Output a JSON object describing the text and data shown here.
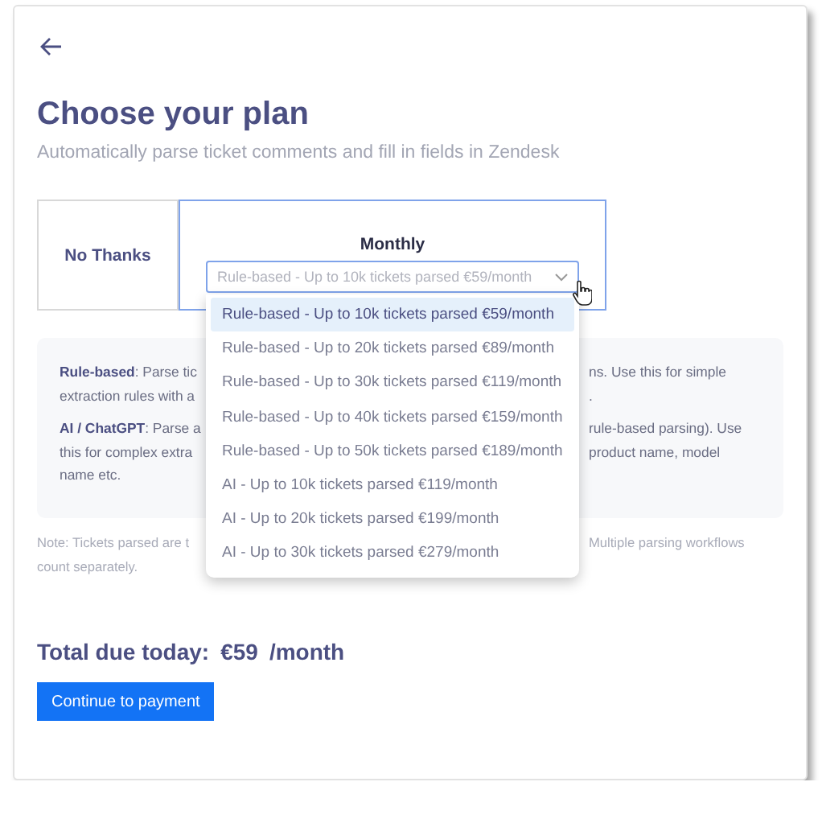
{
  "title": "Choose your plan",
  "subtitle": "Automatically parse ticket comments and fill in fields in Zendesk",
  "plans": [
    {
      "label": "No Thanks",
      "selected": false
    },
    {
      "label": "Monthly",
      "selected": true,
      "select": {
        "value": "Rule-based - Up to 10k tickets parsed €59/month",
        "expanded": true,
        "options": [
          {
            "label": "Rule-based - Up to 10k tickets parsed €59/month",
            "selected": true
          },
          {
            "label": "Rule-based - Up to 20k tickets parsed €89/month",
            "selected": false
          },
          {
            "label": "Rule-based - Up to 30k tickets parsed €119/month",
            "selected": false
          },
          {
            "label": "Rule-based - Up to 40k tickets parsed €159/month",
            "selected": false
          },
          {
            "label": "Rule-based - Up to 50k tickets parsed €189/month",
            "selected": false
          },
          {
            "label": "AI - Up to 10k tickets parsed €119/month",
            "selected": false
          },
          {
            "label": "AI - Up to 20k tickets parsed €199/month",
            "selected": false
          },
          {
            "label": "AI - Up to 30k tickets parsed €279/month",
            "selected": false
          }
        ]
      }
    }
  ],
  "info": [
    {
      "lines": [
        {
          "left": "**Rule-based**: Parse tic",
          "right": "ns. Use this for simple"
        },
        {
          "left": "extraction rules with a",
          "right": "."
        }
      ]
    },
    {
      "lines": [
        {
          "left": "**AI / ChatGPT**: Parse a",
          "right": "rule-based parsing). Use"
        },
        {
          "left": "this for complex extra",
          "right": "product name, model"
        },
        {
          "left": "name etc."
        }
      ]
    }
  ],
  "note": [
    {
      "left": "Note: Tickets parsed are t",
      "right": "Multiple parsing workflows"
    },
    {
      "left": "count separately."
    }
  ],
  "total": {
    "label": "Total due today:",
    "amount": "€59",
    "period": "/month"
  },
  "button": "Continue to payment"
}
